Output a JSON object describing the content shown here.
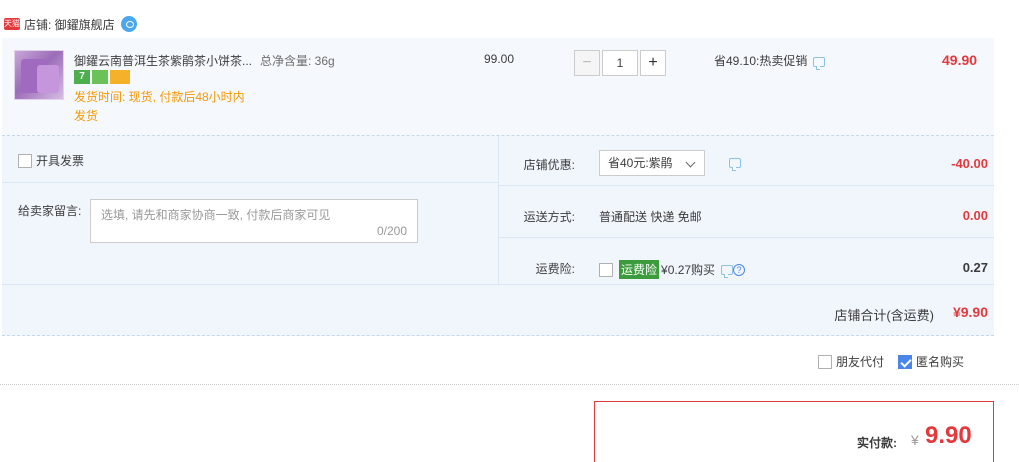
{
  "shop": {
    "badge": "天猫",
    "name": "店铺: 御鑃旗舰店"
  },
  "item": {
    "title": "御鑃云南普洱生茶紫鹃茶小饼茶...",
    "spec": "总净含量: 36g",
    "badges": [
      "7",
      "",
      ""
    ],
    "ship_note": "发货时间: 现货, 付款后48小时内发货",
    "unit_price": "99.00",
    "qty_minus": "−",
    "qty_value": "1",
    "qty_plus": "+",
    "promo": "省49.10:热卖促销",
    "total": "49.90"
  },
  "options": {
    "invoice_label": "开具发票",
    "memo_label": "给卖家留言:",
    "memo_placeholder": "选填, 请先和商家协商一致, 付款后商家可见",
    "memo_count": "0/200",
    "shop_discount_label": "店铺优惠:",
    "shop_discount_value": "省40元:紫鹃",
    "shop_discount_amount": "-40.00",
    "shipping_label": "运送方式:",
    "shipping_value": "普通配送 快递 免邮",
    "shipping_amount": "0.00",
    "insurance_label": "运费险:",
    "insurance_tag": "运费险",
    "insurance_value": "¥0.27购买",
    "insurance_help": "?",
    "insurance_amount": "0.27",
    "subtotal_label": "店铺合计(含运费)",
    "subtotal_amount": "¥9.90"
  },
  "extras": {
    "friend_pay": "朋友代付",
    "anonymous": "匿名购买",
    "anonymous_checked": true
  },
  "payment": {
    "label": "实付款:",
    "currency": "¥",
    "amount": "9.90"
  },
  "colors": {
    "accent_red": "#e4393c",
    "panel_blue": "#f1f6fd",
    "ship_orange": "#f39800"
  }
}
